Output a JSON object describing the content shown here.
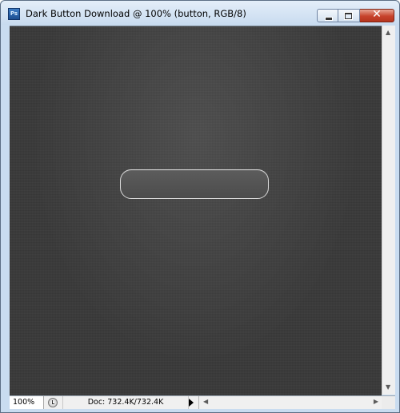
{
  "window": {
    "app_icon": "photoshop-icon",
    "app_icon_text": "Ps",
    "title": "Dark Button Download @ 100% (button, RGB/8)",
    "controls": {
      "minimize": "minimize-icon",
      "maximize": "maximize-icon",
      "close": "close-icon",
      "close_glyph": "✕"
    }
  },
  "canvas": {
    "background_color": "#3a3a3a",
    "shape_stroke_color": "#d8d8d8",
    "shape_fill_color": "#555555"
  },
  "status_bar": {
    "zoom": "100%",
    "doc_info": "Doc: 732.4K/732.4K"
  },
  "scrollbars": {
    "up_arrow": "▲",
    "down_arrow": "▼",
    "left_arrow": "◀",
    "right_arrow": "▶"
  }
}
